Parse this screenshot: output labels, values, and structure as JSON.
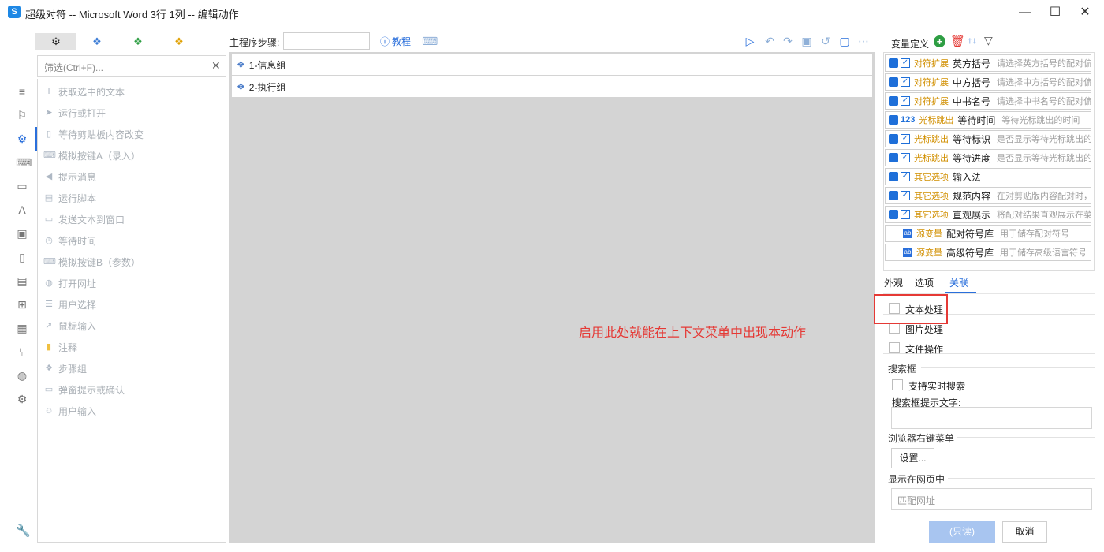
{
  "window": {
    "title": "超级对符 -- Microsoft Word 3行 1列 -- 编辑动作"
  },
  "filter": {
    "placeholder": "筛选(Ctrl+F)..."
  },
  "actions": [
    "获取选中的文本",
    "运行或打开",
    "等待剪贴板内容改变",
    "模拟按键A（录入）",
    "提示消息",
    "运行脚本",
    "发送文本到窗口",
    "等待时间",
    "模拟按键B（参数）",
    "打开网址",
    "用户选择",
    "鼠标输入",
    "注释",
    "步骤组",
    "弹窗提示或确认",
    "用户输入"
  ],
  "main": {
    "steps_label": "主程序步骤:",
    "tutorial_label": "教程",
    "steps": [
      "1-信息组",
      "2-执行组"
    ],
    "annotation": "启用此处就能在上下文菜单中出现本动作"
  },
  "variables": {
    "title": "变量定义",
    "rows": [
      {
        "kind": "check",
        "category": "对符扩展",
        "name": "英方括号",
        "desc": "请选择英方括号的配对偏"
      },
      {
        "kind": "check",
        "category": "对符扩展",
        "name": "中方括号",
        "desc": "请选择中方括号的配对偏"
      },
      {
        "kind": "check",
        "category": "对符扩展",
        "name": "中书名号",
        "desc": "请选择中书名号的配对偏"
      },
      {
        "kind": "number",
        "category": "光标跳出",
        "name": "等待时间",
        "desc": "等待光标跳出的时间"
      },
      {
        "kind": "check",
        "category": "光标跳出",
        "name": "等待标识",
        "desc": "是否显示等待光标跳出的"
      },
      {
        "kind": "check",
        "category": "光标跳出",
        "name": "等待进度",
        "desc": "是否显示等待光标跳出的"
      },
      {
        "kind": "check",
        "category": "其它选项",
        "name": "输入法",
        "desc": ""
      },
      {
        "kind": "check",
        "category": "其它选项",
        "name": "规范内容",
        "desc": "在对剪贴版内容配对时，"
      },
      {
        "kind": "check",
        "category": "其它选项",
        "name": "直观展示",
        "desc": "将配对结果直观展示在菜"
      },
      {
        "kind": "text",
        "category": "源变量",
        "name": "配对符号库",
        "desc": "用于储存配对符号"
      },
      {
        "kind": "text",
        "category": "源变量",
        "name": "高级符号库",
        "desc": "用于储存高级语言符号"
      }
    ]
  },
  "tabs": [
    "外观",
    "选项",
    "关联"
  ],
  "assoc": {
    "text_processing": "文本处理",
    "image_processing": "图片处理",
    "file_operation": "文件操作",
    "search_section": "搜索框",
    "realtime_search": "支持实时搜索",
    "search_hint_label": "搜索框提示文字:",
    "browser_section": "浏览器右键菜单",
    "settings_button": "设置...",
    "show_in_page": "显示在网页中",
    "url_placeholder": "匹配网址"
  },
  "buttons": {
    "ok": "(只读)",
    "cancel": "取消"
  }
}
